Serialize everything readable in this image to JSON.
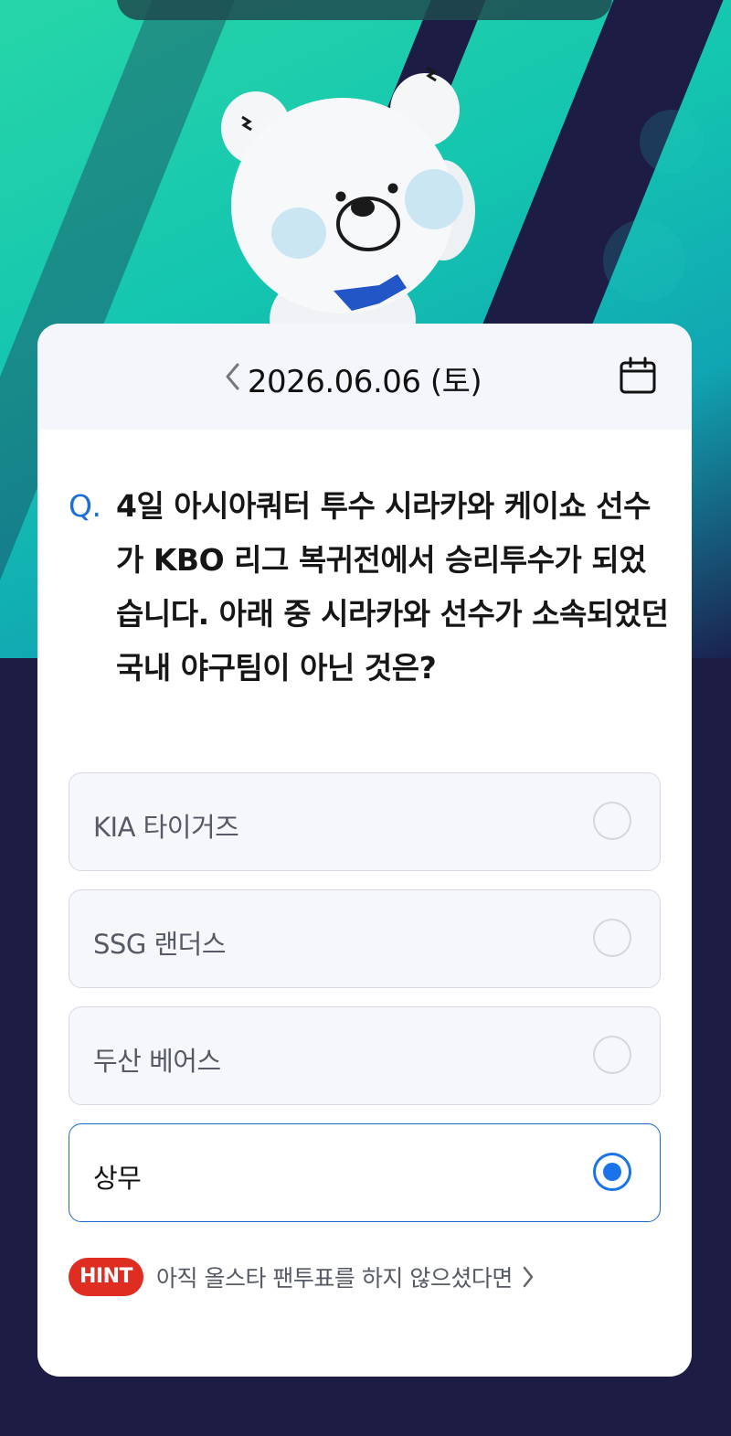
{
  "header": {
    "date": "2026.06.06 (토)",
    "prev_icon": "chevron-left-icon",
    "calendar_icon": "calendar-icon"
  },
  "question": {
    "prefix": "Q.",
    "text": "4일 아시아쿼터 투수 시라카와 케이쇼 선수가 KBO 리그 복귀전에서 승리투수가 되었습니다. 아래 중 시라카와 선수가 소속되었던 국내 야구팀이 아닌 것은?"
  },
  "options": [
    {
      "label": "KIA 타이거즈",
      "selected": false
    },
    {
      "label": "SSG 랜더스",
      "selected": false
    },
    {
      "label": "두산 베어스",
      "selected": false
    },
    {
      "label": "상무",
      "selected": true
    }
  ],
  "hint": {
    "badge": "HINT",
    "text": "아직 올스타 팬투표를 하지 않으셨다면",
    "icon": "chevron-right-icon"
  },
  "colors": {
    "accent": "#1a73e8",
    "hint_badge": "#e02d22",
    "background": "#1c1c45",
    "hero": "#14c5b0"
  }
}
